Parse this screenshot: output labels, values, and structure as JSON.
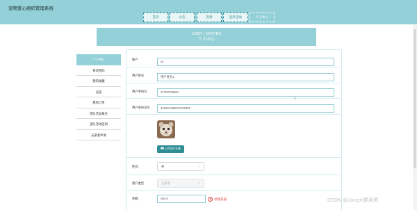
{
  "app": {
    "title": "宠物爱心组织管理系统"
  },
  "nav": {
    "items": [
      "首页",
      "公告",
      "资源",
      "团队活动",
      "个人中心"
    ]
  },
  "banner": {
    "en": "USER / CENTER",
    "zh": "个人中心"
  },
  "sidebar": {
    "items": [
      "个人中心",
      "修改密码",
      "我的收藏",
      "充值",
      "我的订单",
      "团队活动报名",
      "团队活动签到",
      "志愿者申请"
    ]
  },
  "form": {
    "account": {
      "label": "账户",
      "value": "a1"
    },
    "name": {
      "label": "用户姓名",
      "value": "用户姓名1"
    },
    "phone": {
      "label": "用户手机号",
      "value": "17703786901"
    },
    "idcard": {
      "label": "用户身份证号",
      "value": "410224199010102001"
    },
    "upload_label": "上传用户头像",
    "gender": {
      "label": "性别",
      "value": "男"
    },
    "user_type": {
      "label": "用户类型",
      "value": "志愿者"
    },
    "balance": {
      "label": "余额",
      "value": "294.5"
    },
    "recharge_label": "点我充值"
  },
  "watermark": "CSDN @Java大鹅老师",
  "icons": {
    "upload": "upload-icon",
    "chevron": "chevron-down-icon",
    "recharge": "radio-dot-icon"
  },
  "colors": {
    "accent": "#93d0d8",
    "button": "#2f8d94",
    "recharge": "#e0403b"
  }
}
